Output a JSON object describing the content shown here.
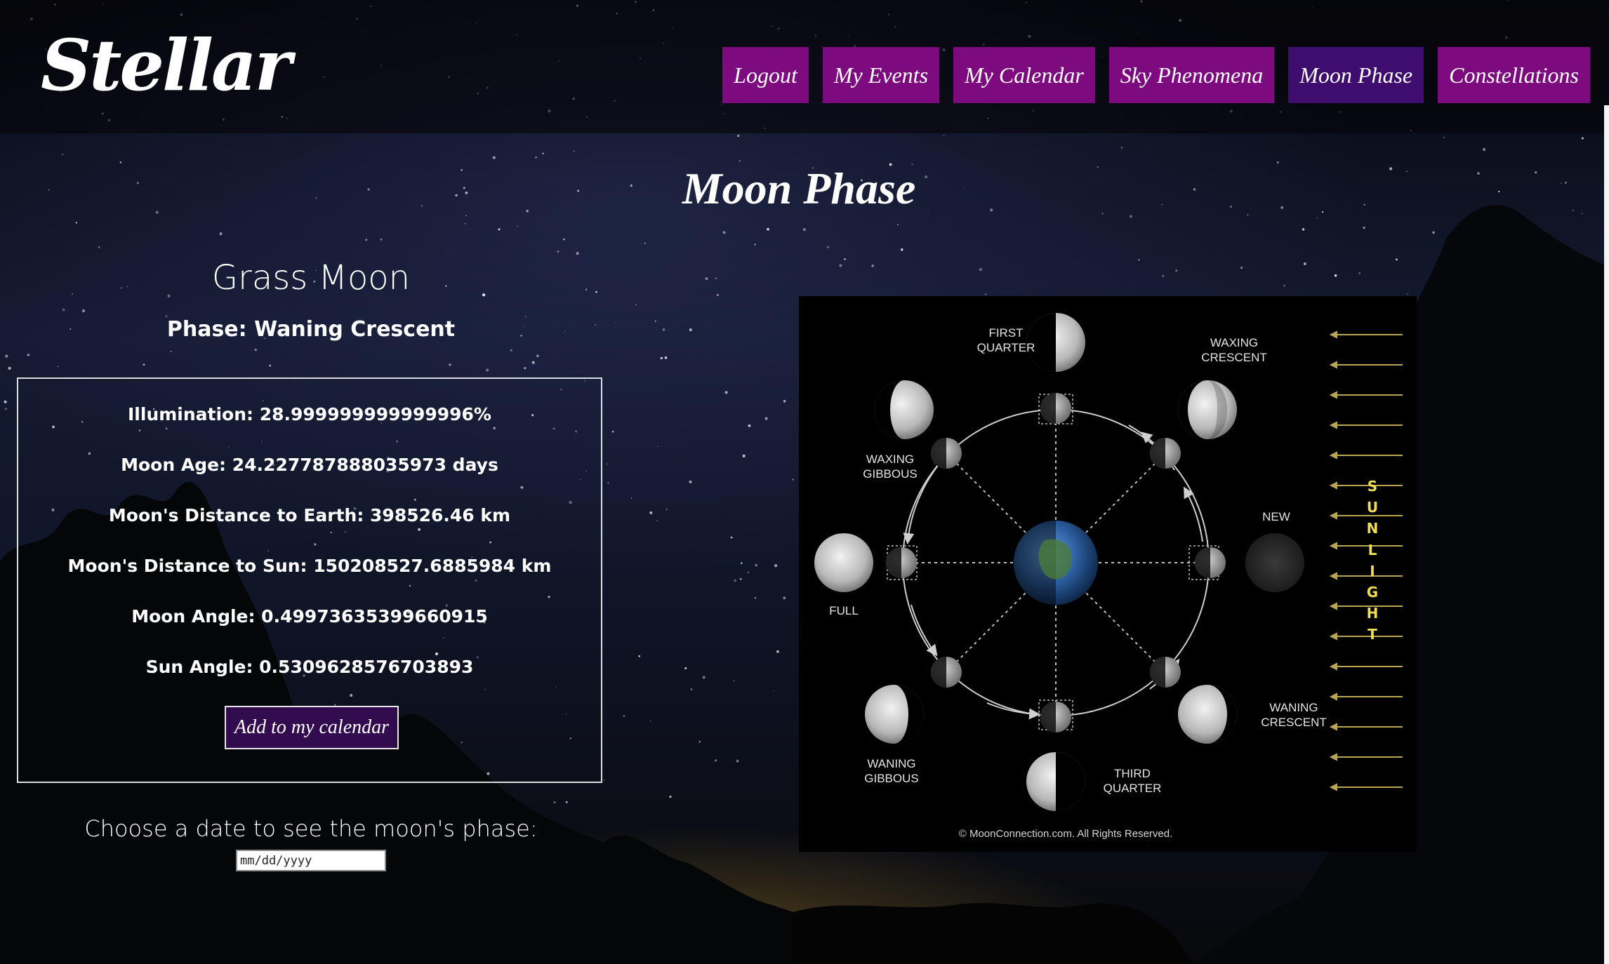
{
  "header": {
    "logo": "Stellar",
    "nav": [
      {
        "label": "Logout",
        "active": false
      },
      {
        "label": "My Events",
        "active": false
      },
      {
        "label": "My Calendar",
        "active": false
      },
      {
        "label": "Sky Phenomena",
        "active": false
      },
      {
        "label": "Moon Phase",
        "active": true
      },
      {
        "label": "Constellations",
        "active": false
      }
    ]
  },
  "page": {
    "title": "Moon Phase"
  },
  "moon": {
    "name": "Grass Moon",
    "phase": "Phase: Waning Crescent",
    "details": [
      "Illumination: 28.999999999999996%",
      "Moon Age: 24.227787888035973 days",
      "Moon's Distance to Earth: 398526.46 km",
      "Moon's Distance to Sun: 150208527.6885984 km",
      "Moon Angle: 0.49973635399660915",
      "Sun Angle: 0.5309628576703893"
    ],
    "add_button": "Add to my calendar"
  },
  "date_picker": {
    "label": "Choose a date to see the moon's phase:",
    "placeholder": "mm/dd/yyyy"
  },
  "diagram": {
    "labels": {
      "first_quarter": "FIRST\nQUARTER",
      "waxing_crescent": "WAXING\nCRESCENT",
      "waxing_gibbous": "WAXING\nGIBBOUS",
      "new": "NEW",
      "full": "FULL",
      "waning_crescent": "WANING\nCRESCENT",
      "waning_gibbous": "WANING\nGIBBOUS",
      "third_quarter": "THIRD\nQUARTER"
    },
    "sunlight": [
      "S",
      "U",
      "N",
      "L",
      "I",
      "G",
      "H",
      "T"
    ],
    "copyright": "© MoonConnection.com. All Rights Reserved."
  },
  "colors": {
    "nav_button": "#7d0a7f",
    "nav_active": "#3e0d6d",
    "add_button": "#330c4f",
    "sunlight": "#f0dd55"
  }
}
